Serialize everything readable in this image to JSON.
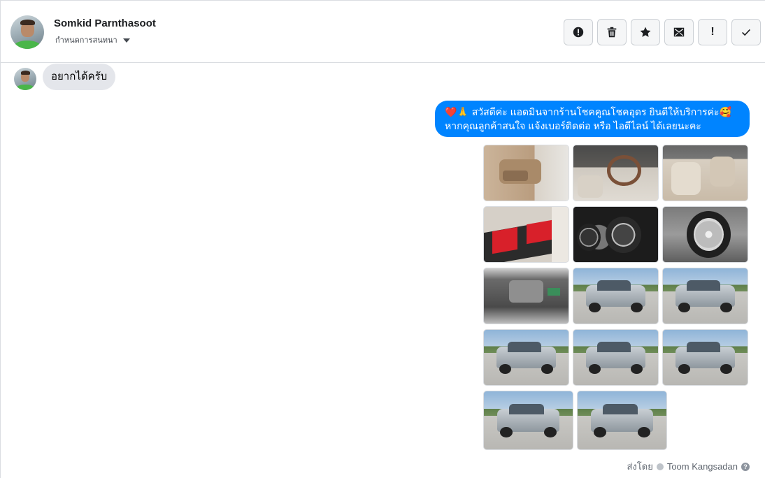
{
  "header": {
    "name": "Somkid Parnthasoot",
    "subtitle": "กำหนดการสนทนา"
  },
  "toolbar": {
    "buttons": [
      {
        "icon": "exclamation-circle-icon"
      },
      {
        "icon": "trash-icon"
      },
      {
        "icon": "star-icon"
      },
      {
        "icon": "envelope-icon"
      },
      {
        "icon": "exclamation-icon",
        "glyph": "!"
      },
      {
        "icon": "checkmark-icon"
      }
    ]
  },
  "conversation": {
    "incoming_message": "อยากได้ครับ",
    "outgoing_message": {
      "line1": "❤️🙏 สวัสดีค่ะ แอดมินจากร้านโชคคูณโชคอุดร ยินดีให้บริการค่ะ🥰",
      "line2": "หากคุณลูกค้าสนใจ แจ้งเบอร์ติดต่อ หรือ ไอดีไลน์ ได้เลยนะคะ"
    },
    "photos": [
      "door-panel-photo",
      "steering-wheel-photo",
      "front-seats-photo",
      "red-seat-photo",
      "gauge-cluster-photo",
      "wheel-photo",
      "engine-bay-photo",
      "truck-front-left-photo",
      "truck-rear-photo",
      "truck-side-photo",
      "truck-rear-left-photo",
      "truck-rear-right-photo",
      "truck-front-photo",
      "truck-front-angle-photo"
    ],
    "sent_by_label": "ส่งโดย",
    "sent_by_name": "Toom Kangsadan",
    "help_glyph": "?"
  },
  "colors": {
    "outgoing_bubble": "#0084ff",
    "incoming_bubble": "#e4e6eb"
  }
}
